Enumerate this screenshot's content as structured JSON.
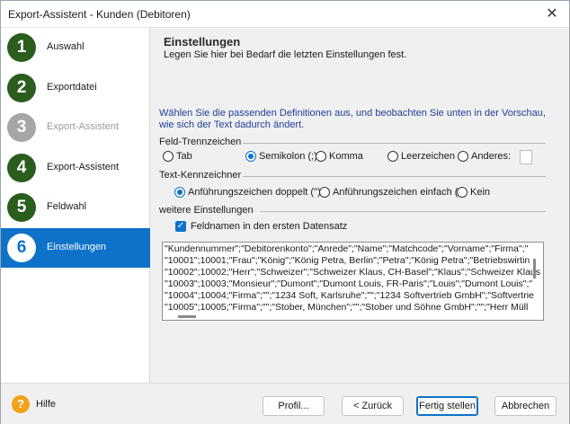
{
  "window": {
    "title": "Export-Assistent - Kunden (Debitoren)",
    "close_symbol": "✕"
  },
  "steps": [
    {
      "number": "1",
      "label": "Auswahl",
      "state": "done"
    },
    {
      "number": "2",
      "label": "Exportdatei",
      "state": "done"
    },
    {
      "number": "3",
      "label": "Export-Assistent",
      "state": "disabled"
    },
    {
      "number": "4",
      "label": "Export-Assistent",
      "state": "done"
    },
    {
      "number": "5",
      "label": "Feldwahl",
      "state": "done"
    },
    {
      "number": "6",
      "label": "Einstellungen",
      "state": "active"
    }
  ],
  "main": {
    "title": "Einstellungen",
    "subtitle": "Legen Sie hier bei Bedarf die letzten Einstellungen fest.",
    "intro": "Wählen Sie die passenden Definitionen aus, und beobachten Sie unten in der Vorschau, wie sich der Text dadurch ändert."
  },
  "field_separator": {
    "label": "Feld-Trennzeichen",
    "options": [
      "Tab",
      "Semikolon (;)",
      "Komma",
      "Leerzeichen",
      "Anderes:"
    ],
    "selected": "Semikolon (;)"
  },
  "text_qualifier": {
    "label": "Text-Kennzeichner",
    "options": [
      "Anführungszeichen doppelt (\")",
      "Anführungszeichen einfach (')",
      "Kein"
    ],
    "selected": "Anführungszeichen doppelt (\")"
  },
  "further": {
    "label": "weitere Einstellungen",
    "field_names_label": "Feldnamen in den ersten Datensatz",
    "field_names_checked": true
  },
  "preview_lines": [
    "\"Kundennummer\";\"Debitorenkonto\";\"Anrede\";\"Name\";\"Matchcode\";\"Vorname\";\"Firma\";\"",
    "\"10001\";10001;\"Frau\";\"König\";\"König Petra, Berlin\";\"Petra\";\"König Petra\";\"Betriebswirtin",
    "\"10002\";10002;\"Herr\";\"Schweizer\";\"Schweizer Klaus, CH-Basel\";\"Klaus\";\"Schweizer Klaus",
    "\"10003\";10003;\"Monsieur\";\"Dumont\";\"Dumont Louis, FR-Paris\";\"Louis\";\"Dumont Louis\";\"",
    "\"10004\";10004;\"Firma\";\"\";\"1234 Soft, Karlsruhe\";\"\";\"1234 Softvertrieb GmbH\";\"Softvertrie",
    "\"10005\";10005;\"Firma\";\"\";\"Stober, München\";\"\";\"Stober und Söhne GmbH\";\"\";\"Herr Müll"
  ],
  "footer": {
    "help_label": "Hilfe",
    "help_symbol": "?",
    "buttons": {
      "profile": "Profil...",
      "back": "< Zurück",
      "finish": "Fertig stellen",
      "cancel": "Abbrechen"
    }
  },
  "colors": {
    "accent": "#0e72c9",
    "step_green": "#2b5d1c",
    "disabled_grey": "#a6a6a6",
    "help_orange": "#f3a21b"
  }
}
